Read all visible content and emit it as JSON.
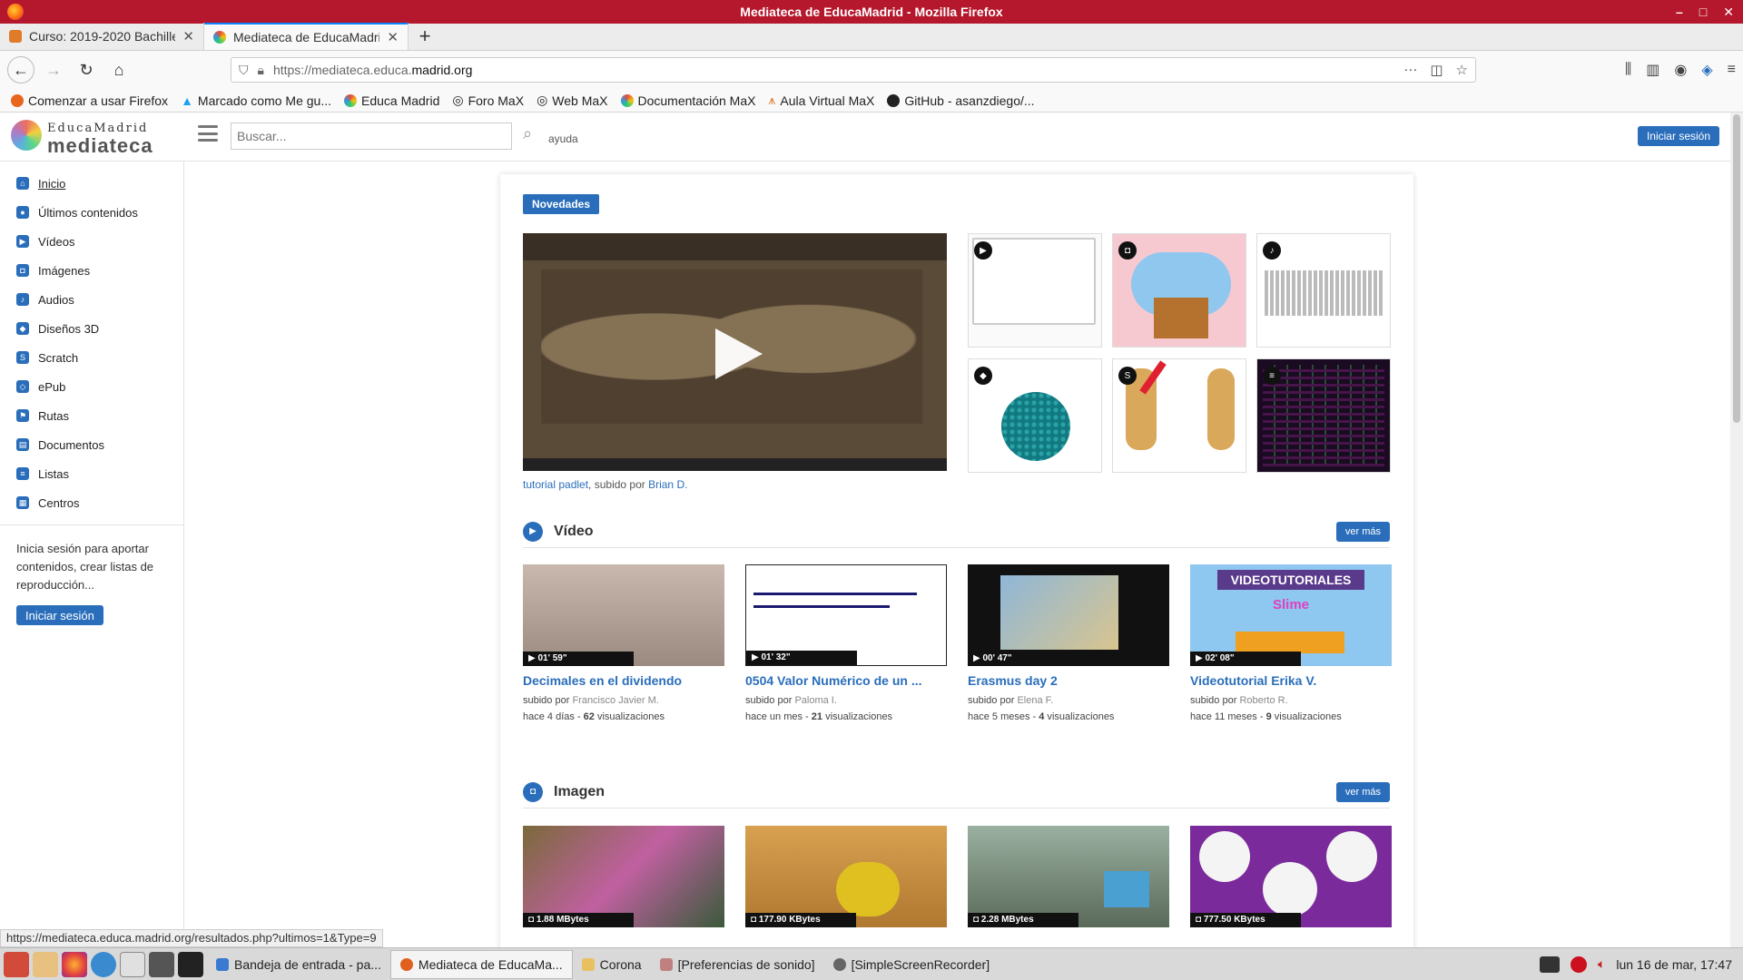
{
  "window": {
    "title": "Mediateca de EducaMadrid - Mozilla Firefox"
  },
  "tabs": [
    {
      "label": "Curso: 2019-2020 Bachille",
      "active": false
    },
    {
      "label": "Mediateca de EducaMadri",
      "active": true
    }
  ],
  "urlbar": {
    "prefix": "https://mediateca.educa.",
    "host": "madrid.org"
  },
  "bookmarks": [
    "Comenzar a usar Firefox",
    "Marcado como Me gu...",
    "Educa Madrid",
    "Foro MaX",
    "Web MaX",
    "Documentación MaX",
    "Aula Virtual MaX",
    "GitHub - asanzdiego/..."
  ],
  "site": {
    "logo_top": "EducaMadrid",
    "logo_bottom": "mediateca",
    "search_placeholder": "Buscar...",
    "help": "ayuda",
    "login": "Iniciar sesión"
  },
  "sidebar": {
    "items": [
      {
        "label": "Inicio",
        "icon": "home-icon",
        "glyph": "⌂"
      },
      {
        "label": "Últimos contenidos",
        "icon": "recent-icon",
        "glyph": "●"
      },
      {
        "label": "Vídeos",
        "icon": "video-icon",
        "glyph": "▶"
      },
      {
        "label": "Imágenes",
        "icon": "camera-icon",
        "glyph": "◘"
      },
      {
        "label": "Audios",
        "icon": "audio-icon",
        "glyph": "♪"
      },
      {
        "label": "Diseños 3D",
        "icon": "cube-icon",
        "glyph": "◆"
      },
      {
        "label": "Scratch",
        "icon": "scratch-icon",
        "glyph": "S"
      },
      {
        "label": "ePub",
        "icon": "epub-icon",
        "glyph": "◇"
      },
      {
        "label": "Rutas",
        "icon": "flag-icon",
        "glyph": "⚑"
      },
      {
        "label": "Documentos",
        "icon": "document-icon",
        "glyph": "▤"
      },
      {
        "label": "Listas",
        "icon": "list-icon",
        "glyph": "≡"
      },
      {
        "label": "Centros",
        "icon": "building-icon",
        "glyph": "▦"
      }
    ],
    "login_text": "Inicia sesión para aportar contenidos, crear listas de reproducción...",
    "login_button": "Iniciar sesión"
  },
  "novedades": {
    "label": "Novedades",
    "featured_title": "tutorial padlet",
    "uploaded_by_label": ", subido por ",
    "featured_author": "Brian D."
  },
  "video_section": {
    "title": "Vídeo",
    "more": "ver más",
    "cards": [
      {
        "title": "Decimales en el dividendo",
        "duration": "01' 59\"",
        "author": "Francisco Javier M.",
        "ago": "hace 4 días",
        "views": "62",
        "views_label": "visualizaciones"
      },
      {
        "title": "0504 Valor Numérico de un ...",
        "duration": "01' 32\"",
        "author": "Paloma I.",
        "ago": "hace un mes",
        "views": "21",
        "views_label": "visualizaciones"
      },
      {
        "title": "Erasmus day 2",
        "duration": "00' 47\"",
        "author": "Elena F.",
        "ago": "hace 5 meses",
        "views": "4",
        "views_label": "visualizaciones"
      },
      {
        "title": "Videotutorial Erika V.",
        "duration": "02' 08\"",
        "author": "Roberto R.",
        "ago": "hace 11 meses",
        "views": "9",
        "views_label": "visualizaciones",
        "thumb_text_1": "VIDEOTUTORIALES",
        "thumb_text_2": "Slime"
      }
    ],
    "uploaded_by": "subido por"
  },
  "image_section": {
    "title": "Imagen",
    "more": "ver más",
    "cards": [
      {
        "size": "1.88 MBytes"
      },
      {
        "size": "177.90 KBytes"
      },
      {
        "size": "2.28 MBytes"
      },
      {
        "size": "777.50 KBytes"
      }
    ]
  },
  "status_url": "https://mediateca.educa.madrid.org/resultados.php?ultimos=1&Type=9",
  "taskbar": {
    "windows": [
      {
        "label": "Bandeja de entrada - pa...",
        "active": false
      },
      {
        "label": "Mediateca de EducaMa...",
        "active": true
      },
      {
        "label": "Corona",
        "active": false
      },
      {
        "label": "[Preferencias de sonido]",
        "active": false
      },
      {
        "label": "[SimpleScreenRecorder]",
        "active": false
      }
    ],
    "clock": "lun 16 de mar, 17:47"
  },
  "colors": {
    "accent": "#2a6ebb",
    "titlebar": "#b5172c"
  }
}
